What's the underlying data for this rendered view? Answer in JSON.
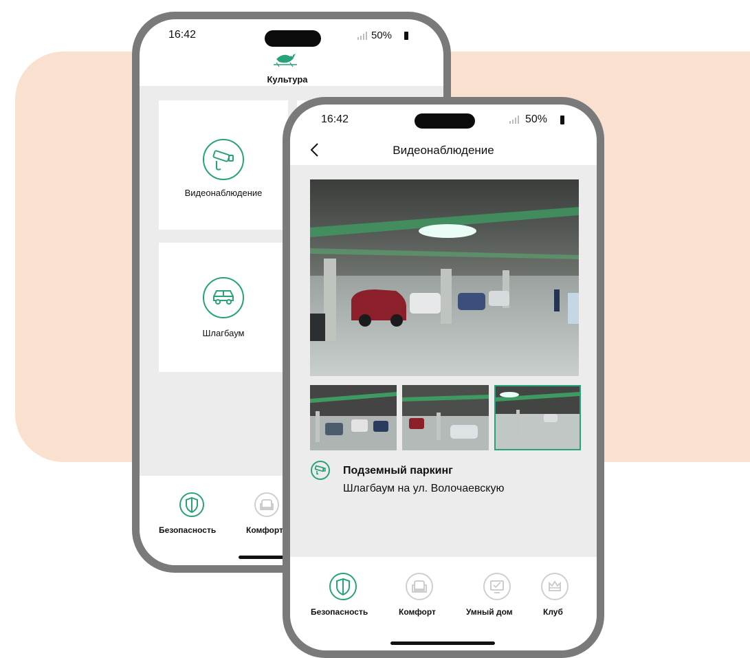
{
  "colors": {
    "accent": "#27a27a",
    "peach": "#f9e0cf",
    "gray_bg": "#ececec",
    "inactive": "#c8c8c8"
  },
  "back_phone": {
    "status": {
      "time": "16:42",
      "battery": "50%"
    },
    "header": {
      "title": "Культура",
      "logo_icon": "bird-logo-icon"
    },
    "tiles": [
      {
        "label": "Видеонаблюдение",
        "icon": "cctv-camera-icon"
      },
      {
        "label": "Шлагбаум",
        "icon": "car-icon"
      }
    ],
    "nav": [
      {
        "label": "Безопасность",
        "icon": "shield-icon",
        "active": true
      },
      {
        "label": "Комфорт",
        "icon": "armchair-icon",
        "active": false
      }
    ]
  },
  "front_phone": {
    "status": {
      "time": "16:42",
      "battery": "50%"
    },
    "header": {
      "title": "Видеонаблюдение",
      "back_icon": "chevron-left-icon"
    },
    "camera": {
      "title": "Подземный паркинг",
      "subtitle": "Шлагбаум на ул. Волочаевскую",
      "icon": "cctv-camera-icon",
      "selected_thumbnail": 3
    },
    "nav": [
      {
        "label": "Безопасность",
        "icon": "shield-icon",
        "active": true
      },
      {
        "label": "Комфорт",
        "icon": "armchair-icon",
        "active": false
      },
      {
        "label": "Умный дом",
        "icon": "monitor-icon",
        "active": false
      },
      {
        "label": "Клуб",
        "icon": "crown-icon",
        "active": false
      }
    ]
  }
}
